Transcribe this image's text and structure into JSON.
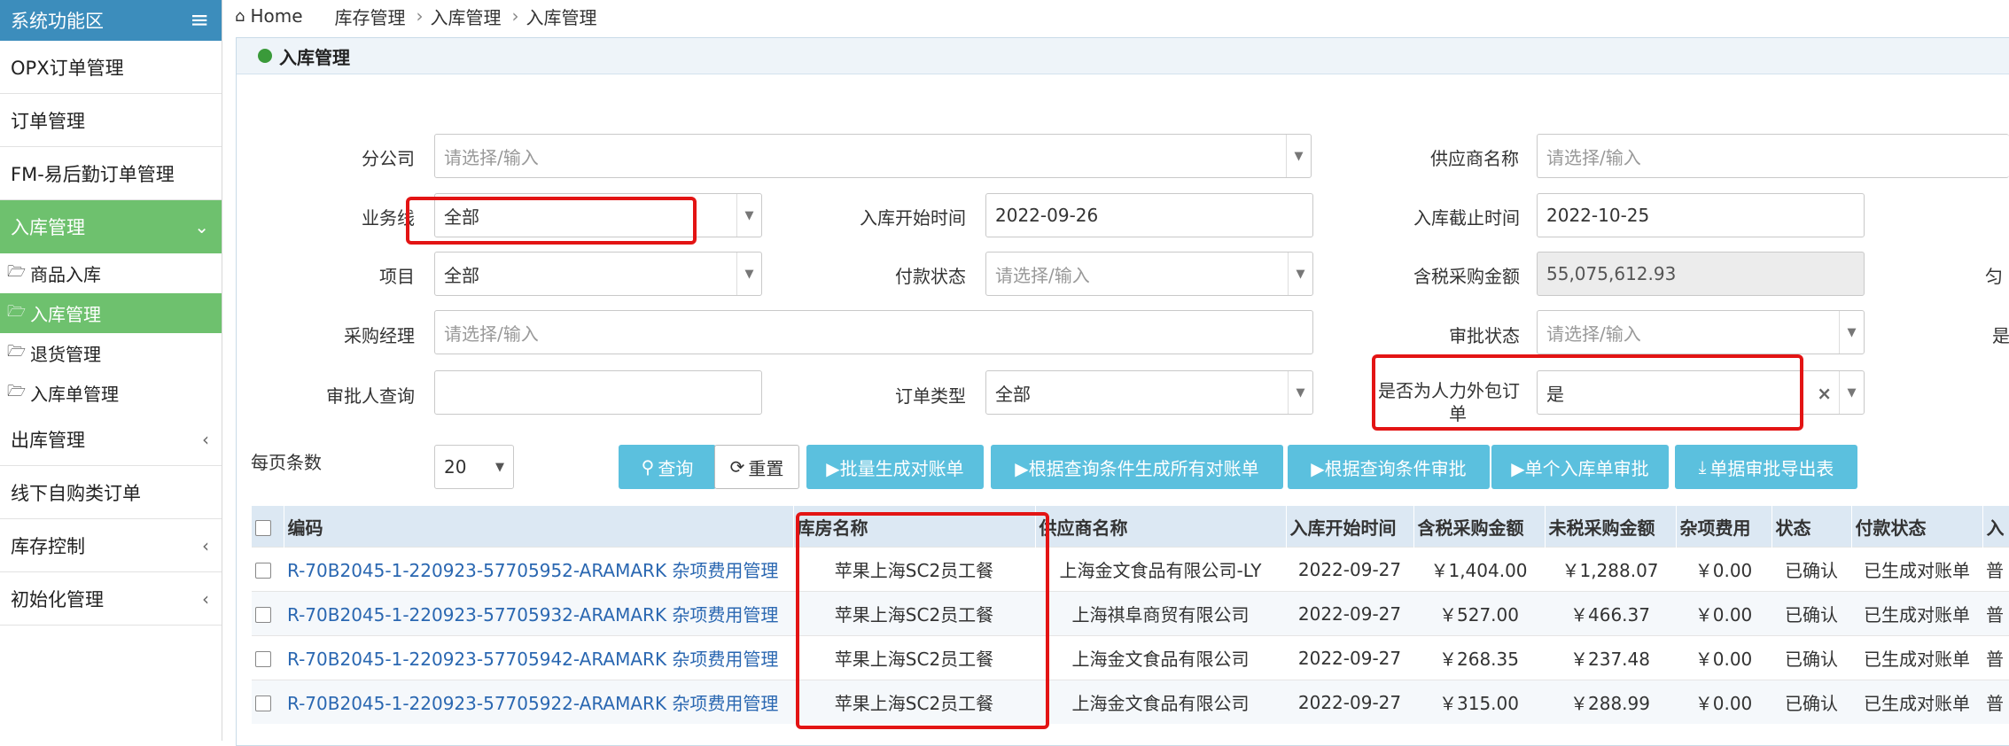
{
  "sidebar": {
    "title": "系统功能区",
    "items": [
      {
        "label": "OPX订单管理"
      },
      {
        "label": "订单管理"
      },
      {
        "label": "FM-易后勤订单管理"
      },
      {
        "label": "入库管理"
      },
      {
        "label": "出库管理"
      },
      {
        "label": "线下自购类订单"
      },
      {
        "label": "库存控制"
      },
      {
        "label": "初始化管理"
      }
    ],
    "subitems": [
      {
        "label": "商品入库"
      },
      {
        "label": "入库管理"
      },
      {
        "label": "退货管理"
      },
      {
        "label": "入库单管理"
      }
    ]
  },
  "breadcrumb": {
    "home": "Home",
    "level1": "库存管理",
    "level2": "入库管理",
    "level3": "入库管理"
  },
  "panel": {
    "title": "入库管理"
  },
  "form": {
    "company_label": "分公司",
    "company_placeholder": "请选择/输入",
    "supplier_label": "供应商名称",
    "supplier_placeholder": "请选择/输入",
    "business_label": "业务线",
    "business_value": "全部",
    "start_label": "入库开始时间",
    "start_value": "2022-09-26",
    "end_label": "入库截止时间",
    "end_value": "2022-10-25",
    "project_label": "项目",
    "project_value": "全部",
    "payment_label": "付款状态",
    "payment_placeholder": "请选择/输入",
    "amount_label": "含税采购金额",
    "amount_value": "55,075,612.93",
    "manager_label": "采购经理",
    "manager_placeholder": "请选择/输入",
    "approval_label": "审批状态",
    "approval_placeholder": "请选择/输入",
    "approver_label": "审批人查询",
    "ordertype_label": "订单类型",
    "ordertype_value": "全部",
    "outsourced_label_1": "是否为人力外包订",
    "outsourced_label_2": "单",
    "outsourced_value": "是",
    "right_cut_1": "匀",
    "right_cut_2": "是",
    "pagesize_label": "每页条数",
    "pagesize_value": "20"
  },
  "toolbar": {
    "query": "查询",
    "reset": "重置",
    "batch_generate": "▶批量生成对账单",
    "generate_all": "▶根据查询条件生成所有对账单",
    "approve_by_query": "▶根据查询条件审批",
    "approve_single": "▶单个入库单审批",
    "export": "单据审批导出表"
  },
  "table": {
    "headers": [
      "编码",
      "库房名称",
      "供应商名称",
      "入库开始时间",
      "含税采购金额",
      "未税采购金额",
      "杂项费用",
      "状态",
      "付款状态",
      "入"
    ],
    "rows": [
      {
        "code": "R-70B2045-1-220923-57705952-ARAMARK 杂项费用管理",
        "warehouse": "苹果上海SC2员工餐",
        "supplier": "上海金文食品有限公司-LY",
        "date": "2022-09-27",
        "tax": "￥1,404.00",
        "notax": "￥1,288.07",
        "misc": "￥0.00",
        "status": "已确认",
        "pay": "已生成对账单",
        "extra": "普"
      },
      {
        "code": "R-70B2045-1-220923-57705932-ARAMARK 杂项费用管理",
        "warehouse": "苹果上海SC2员工餐",
        "supplier": "上海祺阜商贸有限公司",
        "date": "2022-09-27",
        "tax": "￥527.00",
        "notax": "￥466.37",
        "misc": "￥0.00",
        "status": "已确认",
        "pay": "已生成对账单",
        "extra": "普"
      },
      {
        "code": "R-70B2045-1-220923-57705942-ARAMARK 杂项费用管理",
        "warehouse": "苹果上海SC2员工餐",
        "supplier": "上海金文食品有限公司",
        "date": "2022-09-27",
        "tax": "￥268.35",
        "notax": "￥237.48",
        "misc": "￥0.00",
        "status": "已确认",
        "pay": "已生成对账单",
        "extra": "普"
      },
      {
        "code": "R-70B2045-1-220923-57705922-ARAMARK 杂项费用管理",
        "warehouse": "苹果上海SC2员工餐",
        "supplier": "上海金文食品有限公司",
        "date": "2022-09-27",
        "tax": "￥315.00",
        "notax": "￥288.99",
        "misc": "￥0.00",
        "status": "已确认",
        "pay": "已生成对账单",
        "extra": "普"
      }
    ]
  }
}
